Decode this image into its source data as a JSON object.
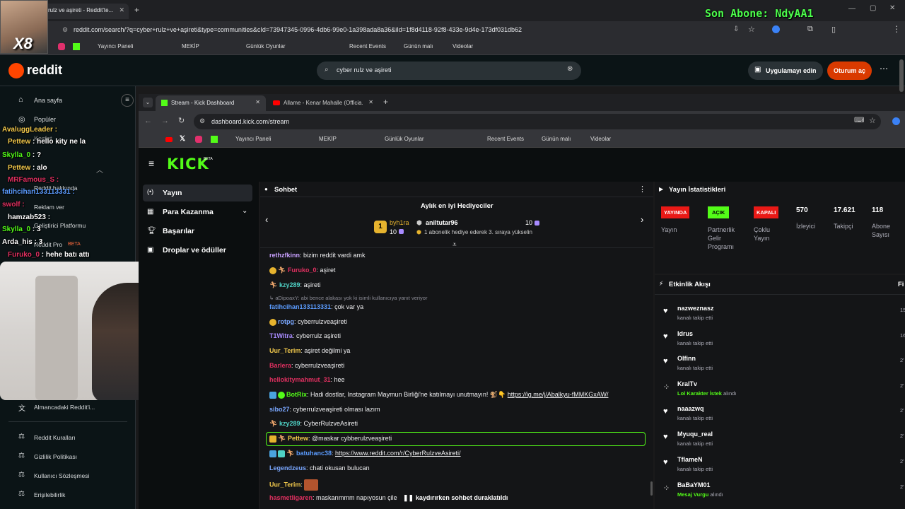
{
  "outer_browser": {
    "tab_title": "rulz ve aşireti - Reddit'te...",
    "url": "reddit.com/search/?q=cyber+rulz+ve+aşireti&type=communities&cId=73947345-0996-4db6-99e0-1a398ada8a36&iId=1f8d4118-92f8-433e-9d4e-173df031db62",
    "bookmarks": [
      "Yayıncı Paneli",
      "MEKİP",
      "Günlük Oyunlar",
      "Recent Events",
      "Günün malı",
      "Videolar"
    ]
  },
  "overlay": {
    "last_sub": "Son Abone: NdyAA1",
    "avatar_label": "X8"
  },
  "reddit": {
    "logo": "reddit",
    "search_value": "cyber rulz ve aşireti",
    "app_button": "Uygulamayı edin",
    "login_button": "Oturum aç",
    "nav": [
      "Ana sayfa",
      "Popüler",
      "Keşfet",
      "Reddit hakkında",
      "Reklam ver",
      "Geliştirici Platformu",
      "Reddit Pro"
    ],
    "nav_beta": "BETA",
    "nav_bottom": [
      "Almancadaki Reddit'i...",
      "Reddit Kuralları",
      "Gizlilik Politikası",
      "Kullanıcı Sözleşmesi",
      "Erişilebilirlik"
    ]
  },
  "stream_overlay_chat": [
    {
      "user": "AvaluggLeader",
      "text": ""
    },
    {
      "user": "Pettew",
      "text": "hello kity ne la"
    },
    {
      "user": "Skylla_0",
      "text": "?"
    },
    {
      "user": "Pettew",
      "text": "alo"
    },
    {
      "user": "MRFamous_S",
      "text": ""
    },
    {
      "user": "fatihcihan133113331",
      "text": ""
    },
    {
      "user": "swolf",
      "text": ""
    },
    {
      "user": "hamzab523",
      "text": ""
    },
    {
      "user": "Skylla_0",
      "text": "3"
    },
    {
      "user": "Arda_his",
      "text": "3"
    },
    {
      "user": "Furuko_0",
      "text": "hehe batı attı"
    }
  ],
  "inner_browser": {
    "tabs": [
      "Stream - Kick Dashboard",
      "Allame - Kenar Mahalle (Officia..."
    ],
    "url": "dashboard.kick.com/stream",
    "bookmarks": [
      "Yayıncı Paneli",
      "MEKİP",
      "Günlük Oyunlar",
      "Recent Events",
      "Günün malı",
      "Videolar"
    ]
  },
  "kick": {
    "logo": "KICK",
    "logo_beta": "BETA",
    "menu": [
      "Yayın",
      "Para Kazanma",
      "Başarılar",
      "Droplar ve ödüller"
    ],
    "chat_title": "Sohbet",
    "gifters_title": "Aylık en iyi Hediyeciler",
    "gifter1_name": "byh1ra",
    "gifter1_count": "10",
    "gifter1_rank": "1",
    "gifter2_name": "aniltutar96",
    "gifter2_count": "10",
    "gifter_note": "1 abonelik hediye ederek 3. sıraya yükselin",
    "messages": [
      {
        "user": "rethzfkinn",
        "color": "#c9a0ff",
        "text": "bizim reddit vardi amk"
      },
      {
        "user": "Furuko_0",
        "color": "#e03060",
        "text": "aşiret"
      },
      {
        "user": "kzy289",
        "color": "#4fd1c5",
        "text": "aşireti"
      },
      {
        "user": "fatihcihan133113331",
        "color": "#5b9cff",
        "text": "çok var ya",
        "reply": "aDipoaxY: abi bence alakası yok ki isimli kullanıcıya yanıt veriyor"
      },
      {
        "user": "rotpg",
        "color": "#7aa7ff",
        "text": "cyberrulzveaşireti"
      },
      {
        "user": "T1Witra",
        "color": "#a88bff",
        "text": "cyberrulz aşireti"
      },
      {
        "user": "Uur_Terim",
        "color": "#f2c94c",
        "text": "aşiret değilmi ya"
      },
      {
        "user": "Barlera",
        "color": "#e03060",
        "text": "cyberrulzveaşireti"
      },
      {
        "user": "hellokitymahmut_31",
        "color": "#e03060",
        "text": "hee"
      },
      {
        "user": "BotRix",
        "color": "#53fc18",
        "text": "Hadi dostlar, Instagram Maymun Birliği'ne katılmayı unutmayın! 🐒👇 ",
        "link": "https://ig.me/j/Abalkyu-fMMKGxAW/"
      },
      {
        "user": "sibo27",
        "color": "#7aa7ff",
        "text": "cyberrulzveaşireti olması lazım"
      },
      {
        "user": "kzy289",
        "color": "#4fd1c5",
        "text": "CyberRulzveAsireti"
      },
      {
        "user": "Pettew",
        "color": "#f2c94c",
        "text": "@maskar cybberulzveaşireti",
        "highlight": "yes"
      },
      {
        "user": "batuhanc38",
        "color": "#5b9cff",
        "text": "",
        "link": "https://www.reddit.com/r/CyberRulzveAsireti/"
      },
      {
        "user": "Legendzeus",
        "color": "#7aa7ff",
        "text": "chati okusan bulucan"
      },
      {
        "user": "Uur_Terim",
        "color": "#f2c94c",
        "text": ""
      },
      {
        "user": "hasmetligaren",
        "color": "#e03060",
        "text": "maskarımmm napıyosun çile"
      }
    ],
    "paused_text": "kaydırırken sohbet duraklatıldı",
    "stats_title": "Yayın İstatistikleri",
    "stats": [
      {
        "badge": "YAYINDA",
        "badge_color": "#e91916",
        "label": "Yayın"
      },
      {
        "badge": "AÇIK",
        "badge_color": "#53fc18",
        "label": "Partnerlik Gelir Programı"
      },
      {
        "badge": "KAPALI",
        "badge_color": "#e91916",
        "label": "Çoklu Yayın"
      },
      {
        "value": "570",
        "label": "İzleyici"
      },
      {
        "value": "17.621",
        "label": "Takipçi"
      },
      {
        "value": "118",
        "label": "Abone Sayısı"
      }
    ],
    "events_title": "Etkinlik Akışı",
    "events_filter": "Fi",
    "events": [
      {
        "name": "nazweznasz",
        "sub": "kanalı takip etti",
        "time": "15",
        "icon": "heart"
      },
      {
        "name": "Idrus",
        "sub": "kanalı takip etti",
        "time": "16",
        "icon": "heart"
      },
      {
        "name": "Olfinn",
        "sub": "kanalı takip etti",
        "time": "2'",
        "icon": "heart"
      },
      {
        "name": "KralTv",
        "sub_green": "Lol Karakter İstek",
        "sub": "alındı",
        "time": "2'",
        "icon": "reward"
      },
      {
        "name": "naaazwq",
        "sub": "kanalı takip etti",
        "time": "2'",
        "icon": "heart"
      },
      {
        "name": "Myuqu_real",
        "sub": "kanalı takip etti",
        "time": "2'",
        "icon": "heart"
      },
      {
        "name": "TflameN",
        "sub": "kanalı takip etti",
        "time": "2'",
        "icon": "heart"
      },
      {
        "name": "BaBaYM01",
        "sub_green": "Mesaj Vurgu",
        "sub": "alındı",
        "time": "2'",
        "icon": "reward"
      }
    ]
  }
}
